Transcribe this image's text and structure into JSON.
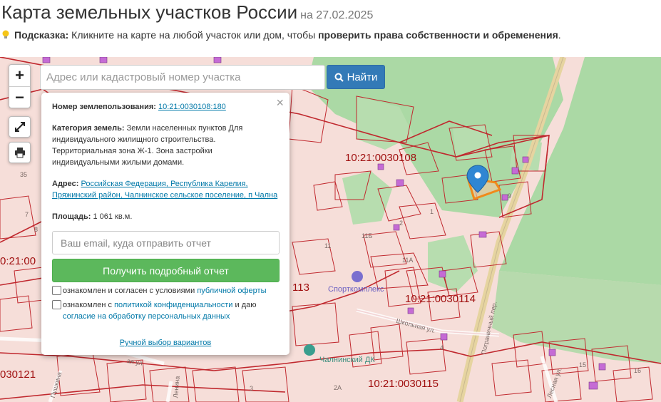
{
  "header": {
    "title": "Карта земельных участков России",
    "date": "на 27.02.2025"
  },
  "hint": {
    "label": "Подсказка:",
    "text": " Кликните на карте на любой участок или дом, чтобы ",
    "bold": "проверить права собственности и обременения",
    "end": "."
  },
  "search": {
    "placeholder": "Адрес или кадастровый номер участка",
    "button": "Найти"
  },
  "controls": {
    "zoom_in": "+",
    "zoom_out": "−"
  },
  "popup": {
    "number_label": "Номер землепользования:",
    "number_value": "10:21:0030108:180",
    "category_label": "Категория земель:",
    "category_value": " Земли населенных пунктов Для индивидуального жилищного строительства. Территориальная зона Ж-1. Зона застройки индивидуальными жилыми домами.",
    "address_label": "Адрес:",
    "address_value": "Российская Федерация, Республика Карелия, Пряжинский район, Чалнинское сельское поселение, п Чална",
    "area_label": "Площадь:",
    "area_value": " 1 061 кв.м.",
    "email_placeholder": "Ваш email, куда отправить отчет",
    "report_button": "Получить подробный отчет",
    "consent1_text": "ознакомлен и согласен с условиями ",
    "consent1_link": "публичной оферты",
    "consent2_text": "ознакомлен с ",
    "consent2_link1": "политикой конфиденциальности",
    "consent2_mid": " и даю",
    "consent2_link2": "согласие на обработку персональных данных",
    "manual_link": "Ручной выбор вариантов",
    "close": "×"
  },
  "map_labels": {
    "cad_108": "10:21:0030108",
    "cad_114": "10:21:0030114",
    "cad_115": "10:21:0030115",
    "cad_left": "0:21:00",
    "cad_left2": "030121",
    "cad_113": "113",
    "sport": "Спорткомплекс",
    "dk": "Чалнинский ДК",
    "street_school": "Школьная ул.",
    "street_border": "Пограничный пер.",
    "street_lenin": "Ленина",
    "street_pushkin": "Пушкина",
    "street_kay": "ая ул.",
    "street_lesn": "Лесная ул.",
    "n_11b": "11Б",
    "n_11a": "11А",
    "n_11": "11",
    "n_1": "1",
    "n_2": "2",
    "n_4": "4",
    "n_9": "9",
    "n_3": "3",
    "n_2a": "2А",
    "n_7": "7",
    "n_8": "8",
    "n_35": "35",
    "n_15": "15",
    "n_16": "16"
  },
  "colors": {
    "parcel_fill": "#f6ded9",
    "parcel_border": "#c0282e",
    "green": "#abd9a5",
    "building": "#c56bd5",
    "marker": "#2f86d3",
    "selected": "#f08a1a"
  }
}
